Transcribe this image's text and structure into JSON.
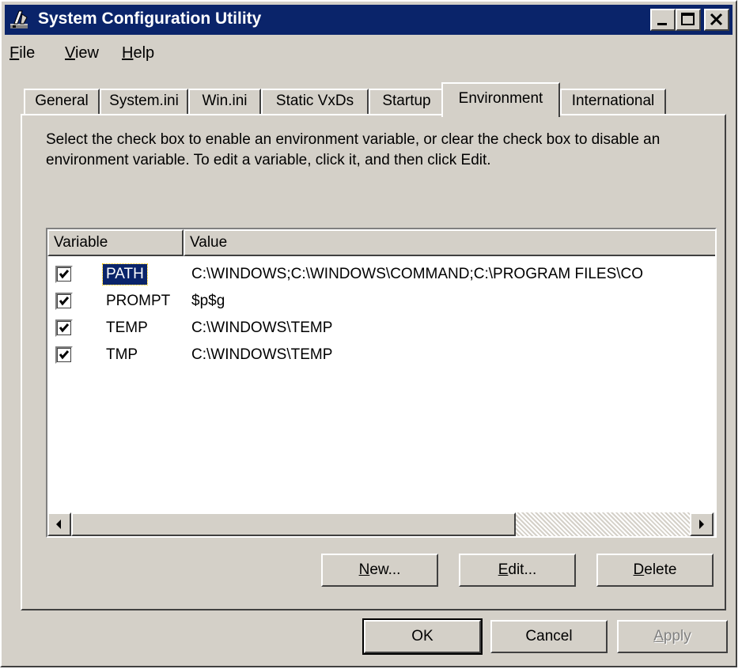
{
  "window": {
    "title": "System Configuration Utility"
  },
  "menu": [
    {
      "label": "File",
      "accel": "F",
      "rest": "ile"
    },
    {
      "label": "View",
      "accel": "V",
      "rest": "iew"
    },
    {
      "label": "Help",
      "accel": "H",
      "rest": "elp"
    }
  ],
  "tabs": [
    {
      "label": "General"
    },
    {
      "label": "System.ini"
    },
    {
      "label": "Win.ini"
    },
    {
      "label": "Static VxDs"
    },
    {
      "label": "Startup"
    },
    {
      "label": "Environment",
      "active": true
    },
    {
      "label": "International"
    }
  ],
  "description": "Select the check box to enable an environment variable, or clear the check box to disable an environment variable. To edit a variable, click it, and then click Edit.",
  "list": {
    "columns": {
      "variable": "Variable",
      "value": "Value"
    },
    "rows": [
      {
        "checked": true,
        "variable": "PATH",
        "value": "C:\\WINDOWS;C:\\WINDOWS\\COMMAND;C:\\PROGRAM FILES\\CO",
        "selected": true
      },
      {
        "checked": true,
        "variable": "PROMPT",
        "value": "$p$g"
      },
      {
        "checked": true,
        "variable": "TEMP",
        "value": "C:\\WINDOWS\\TEMP"
      },
      {
        "checked": true,
        "variable": "TMP",
        "value": "C:\\WINDOWS\\TEMP"
      }
    ]
  },
  "panel_buttons": {
    "new": {
      "accel": "N",
      "rest": "ew..."
    },
    "edit": {
      "accel": "E",
      "rest": "dit..."
    },
    "delete": {
      "accel": "D",
      "rest": "elete"
    }
  },
  "dialog_buttons": {
    "ok": "OK",
    "cancel": "Cancel",
    "apply": {
      "accel": "A",
      "rest": "pply"
    }
  },
  "colors": {
    "face": "#d4d0c8",
    "titlebar": "#0a246a",
    "selection": "#0a246a"
  },
  "icons": [
    "app-icon",
    "minimize-icon",
    "maximize-icon",
    "close-icon",
    "check-icon",
    "scroll-left-icon",
    "scroll-right-icon"
  ]
}
